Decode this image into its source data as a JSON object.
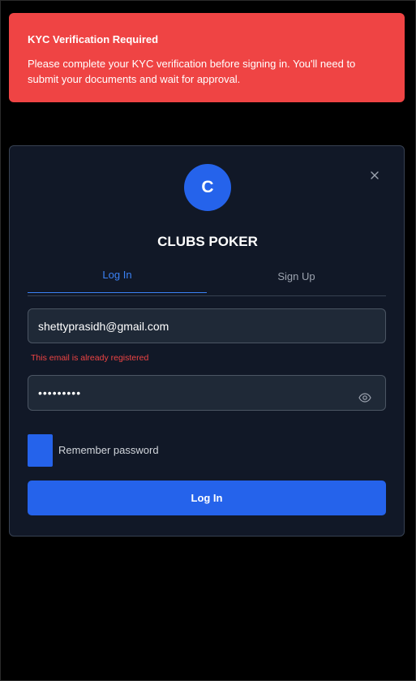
{
  "alert": {
    "title": "KYC Verification Required",
    "message": "Please complete your KYC verification before signing in. You'll need to submit your documents and wait for approval.",
    "color": "#ef4444"
  },
  "modal": {
    "close_icon": "close-icon",
    "avatar_letter": "C",
    "brand_name": "CLUBS POKER",
    "tabs": [
      {
        "label": "Log In",
        "active": true
      },
      {
        "label": "Sign Up",
        "active": false
      }
    ],
    "email": {
      "value": "shettyprasidh@gmail.com",
      "error": "This email is already registered"
    },
    "password": {
      "value": "•••••••••",
      "toggle_icon": "eye-icon"
    },
    "remember_label": "Remember password",
    "submit_label": "Log In"
  },
  "colors": {
    "accent": "#2563eb",
    "panel": "#111827",
    "error": "#ef4444"
  }
}
